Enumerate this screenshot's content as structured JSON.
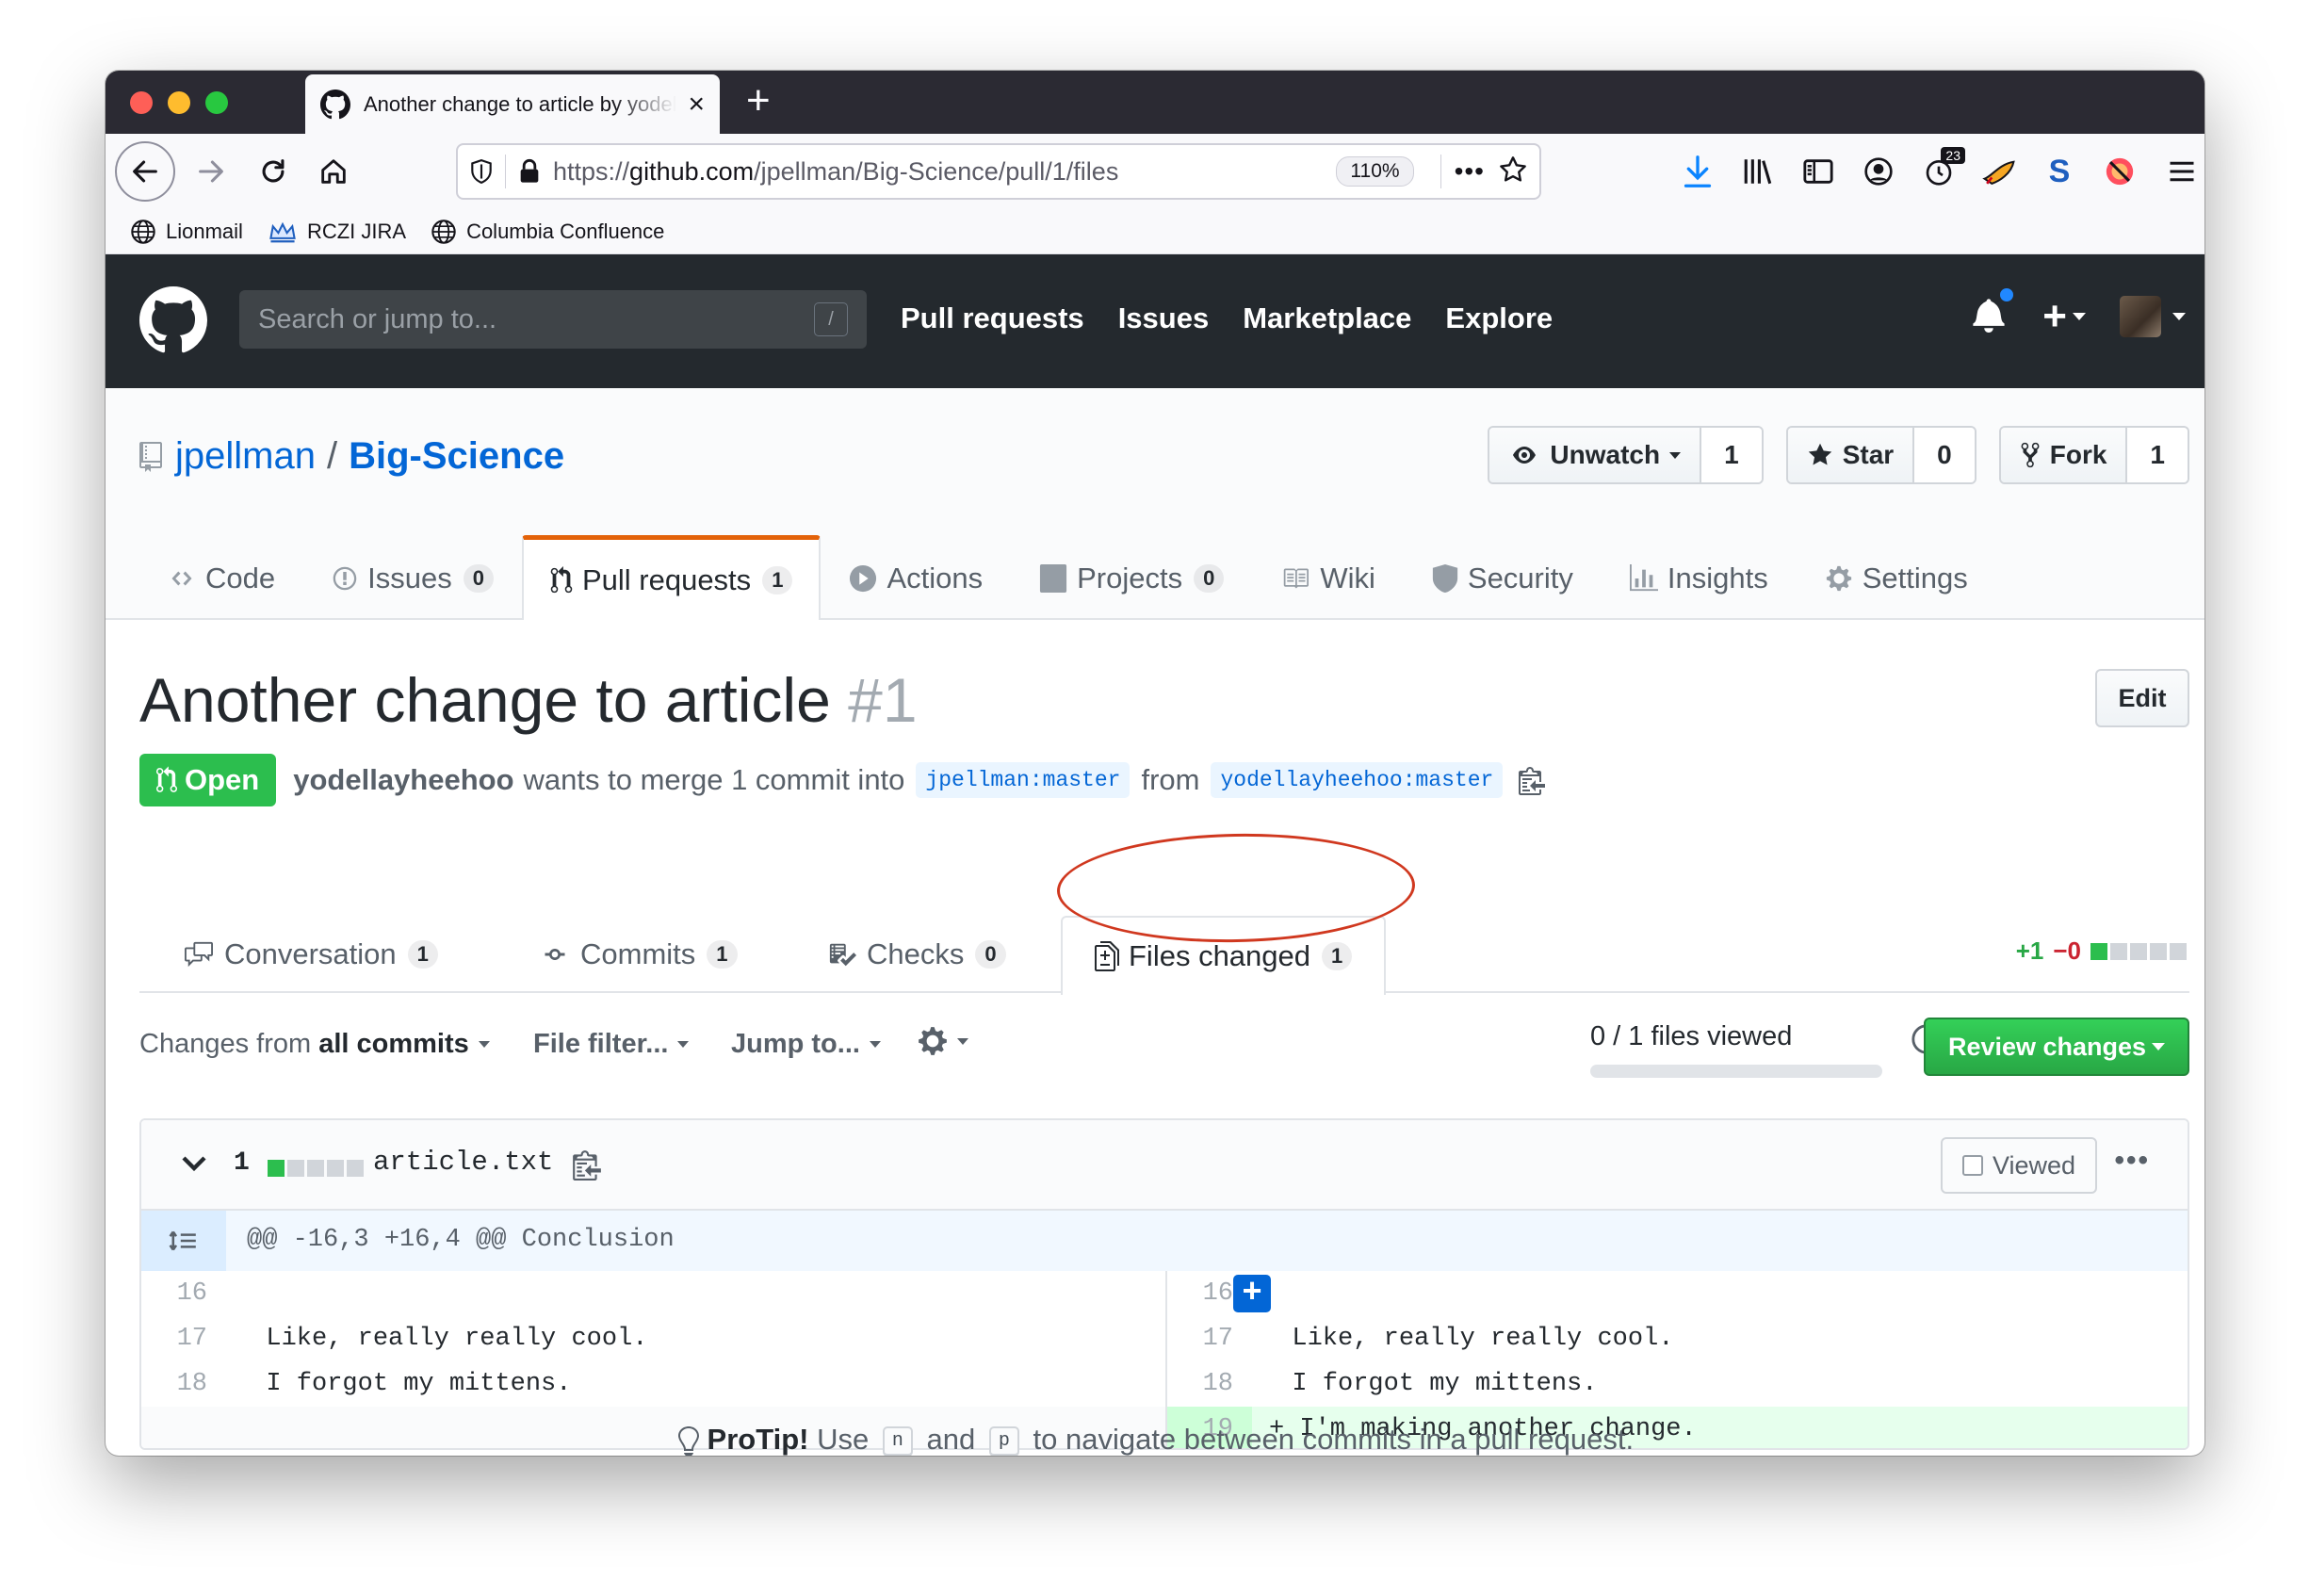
{
  "browser": {
    "tab_title": "Another change to article by yodellayheehoo",
    "url_prefix": "https://",
    "url_host": "github.com",
    "url_path": "/jpellman/Big-Science/pull/1/files",
    "zoom": "110%",
    "toolbar_badge": "23",
    "bookmarks": [
      "Lionmail",
      "RCZI JIRA",
      "Columbia Confluence"
    ]
  },
  "github": {
    "search_placeholder": "Search or jump to...",
    "search_shortcut": "/",
    "nav": [
      "Pull requests",
      "Issues",
      "Marketplace",
      "Explore"
    ]
  },
  "repo": {
    "owner": "jpellman",
    "separator": "/",
    "name": "Big-Science",
    "watch": {
      "label": "Unwatch",
      "count": "1"
    },
    "star": {
      "label": "Star",
      "count": "0"
    },
    "fork": {
      "label": "Fork",
      "count": "1"
    },
    "tabs": [
      {
        "label": "Code",
        "count": ""
      },
      {
        "label": "Issues",
        "count": "0"
      },
      {
        "label": "Pull requests",
        "count": "1"
      },
      {
        "label": "Actions",
        "count": ""
      },
      {
        "label": "Projects",
        "count": "0"
      },
      {
        "label": "Wiki",
        "count": ""
      },
      {
        "label": "Security",
        "count": ""
      },
      {
        "label": "Insights",
        "count": ""
      },
      {
        "label": "Settings",
        "count": ""
      }
    ]
  },
  "pr": {
    "title": "Another change to article",
    "number": "#1",
    "edit_label": "Edit",
    "state": "Open",
    "author": "yodellayheehoo",
    "merge_text": "wants to merge 1 commit into",
    "base_branch": "jpellman:master",
    "from_text": "from",
    "head_branch": "yodellayheehoo:master",
    "tabs": [
      {
        "label": "Conversation",
        "count": "1"
      },
      {
        "label": "Commits",
        "count": "1"
      },
      {
        "label": "Checks",
        "count": "0"
      },
      {
        "label": "Files changed",
        "count": "1"
      }
    ],
    "diffstat": {
      "additions": "+1",
      "deletions": "−0"
    }
  },
  "toolbar": {
    "changes_from_prefix": "Changes from",
    "changes_from_value": "all commits",
    "file_filter": "File filter...",
    "jump_to": "Jump to...",
    "files_viewed": "0 / 1 files viewed",
    "files_viewed_fraction": 0,
    "review_label": "Review changes"
  },
  "file": {
    "change_count": "1",
    "name": "article.txt",
    "viewed_label": "Viewed",
    "hunk_header": "@@ -16,3 +16,4 @@ Conclusion",
    "left_lines": [
      {
        "num": "16",
        "text": ""
      },
      {
        "num": "17",
        "text": "  Like, really really cool."
      },
      {
        "num": "18",
        "text": "  I forgot my mittens."
      }
    ],
    "right_lines": [
      {
        "num": "16",
        "text": ""
      },
      {
        "num": "17",
        "text": "  Like, really really cool."
      },
      {
        "num": "18",
        "text": "  I forgot my mittens."
      },
      {
        "num": "19",
        "text": "+ I'm making another change."
      }
    ]
  },
  "protip": {
    "label": "ProTip!",
    "use": "Use",
    "key_n": "n",
    "and": "and",
    "key_p": "p",
    "rest": "to navigate between commits in a pull request."
  },
  "colors": {
    "accent_orange": "#e36209",
    "open_green": "#2cbe4e",
    "link_blue": "#0366d6",
    "annotation_red": "#d0381f"
  }
}
